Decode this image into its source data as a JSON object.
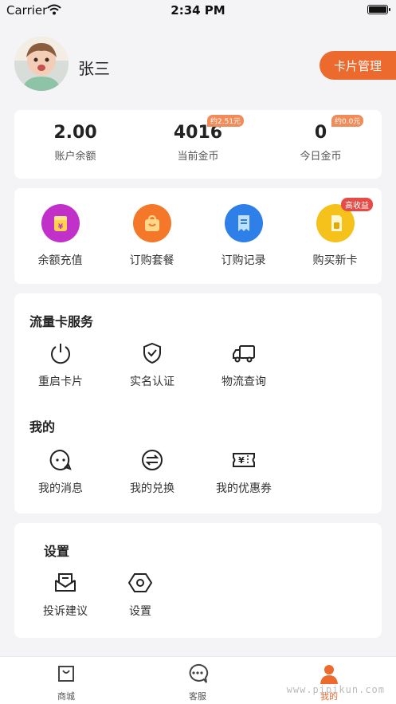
{
  "status_bar": {
    "carrier": "Carrier",
    "time": "2:34 PM"
  },
  "profile": {
    "name": "张三",
    "card_manage_label": "卡片管理"
  },
  "stats": [
    {
      "value": "2.00",
      "label": "账户余额",
      "badge": ""
    },
    {
      "value": "4016",
      "label": "当前金币",
      "badge": "约2.51元"
    },
    {
      "value": "0",
      "label": "今日金币",
      "badge": "约0.0元"
    }
  ],
  "quick_actions": [
    {
      "label": "余额充值",
      "icon": "wallet-icon",
      "color": "#c131c9"
    },
    {
      "label": "订购套餐",
      "icon": "shopping-bag-icon",
      "color": "#f4772a"
    },
    {
      "label": "订购记录",
      "icon": "receipt-icon",
      "color": "#2f7fe8"
    },
    {
      "label": "购买新卡",
      "icon": "sim-card-icon",
      "color": "#f4c21a",
      "badge": "高收益"
    }
  ],
  "services": {
    "title": "流量卡服务",
    "items": [
      {
        "label": "重启卡片",
        "icon": "power-icon"
      },
      {
        "label": "实名认证",
        "icon": "shield-check-icon"
      },
      {
        "label": "物流查询",
        "icon": "truck-icon"
      }
    ]
  },
  "mine": {
    "title": "我的",
    "items": [
      {
        "label": "我的消息",
        "icon": "message-icon"
      },
      {
        "label": "我的兑换",
        "icon": "exchange-icon"
      },
      {
        "label": "我的优惠券",
        "icon": "coupon-icon"
      }
    ]
  },
  "settings": {
    "title": "设置",
    "items": [
      {
        "label": "投诉建议",
        "icon": "mail-icon"
      },
      {
        "label": "设置",
        "icon": "settings-icon"
      }
    ]
  },
  "tabbar": [
    {
      "label": "商城",
      "icon": "shop-icon",
      "active": false
    },
    {
      "label": "客服",
      "icon": "chat-icon",
      "active": false
    },
    {
      "label": "我的",
      "icon": "user-icon",
      "active": true
    }
  ],
  "watermark": "www.pipikun.com",
  "colors": {
    "accent": "#ec6a2d",
    "background": "#f4f4f6",
    "badge": "#f08c5a",
    "high_badge": "#e44c45"
  }
}
